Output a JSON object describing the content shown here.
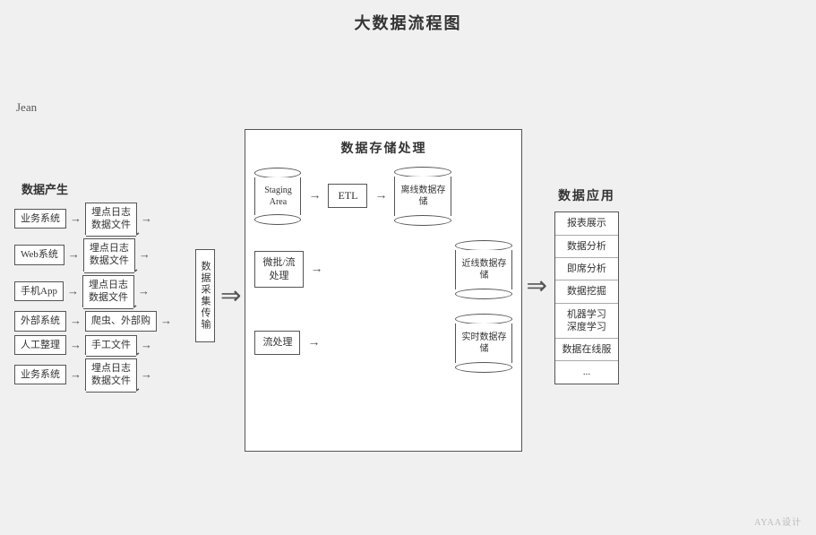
{
  "title": "大数据流程图",
  "sections": {
    "data_source": {
      "label": "数据产生",
      "rows": [
        {
          "left": "业务系统",
          "right_line1": "埋点日志",
          "right_line2": "数据文件",
          "wave": true
        },
        {
          "left": "Web系统",
          "right_line1": "埋点日志",
          "right_line2": "数据文件",
          "wave": true
        },
        {
          "left": "手机App",
          "right_line1": "埋点日志",
          "right_line2": "数据文件",
          "wave": true
        },
        {
          "left": "外部系统",
          "right_line1": "爬虫、外部购",
          "right_line2": "",
          "wave": false
        },
        {
          "left": "人工整理",
          "right_line1": "手工文件",
          "right_line2": "",
          "wave": true
        },
        {
          "left": "业务系统",
          "right_line1": "埋点日志",
          "right_line2": "数据文件",
          "wave": true
        }
      ]
    },
    "collect": {
      "label": "数据\n采集\n传输"
    },
    "storage": {
      "label": "数据存储处理",
      "rows": [
        {
          "left_label": "Staging\nArea",
          "process_label": "ETL",
          "right_label1": "离线数据存",
          "right_label2": "储"
        },
        {
          "left_label": "微批/流\n处理",
          "process_label": null,
          "right_label1": "近线数据存",
          "right_label2": "储"
        },
        {
          "left_label": "流处理",
          "process_label": null,
          "right_label1": "实时数据存",
          "right_label2": "储"
        }
      ]
    },
    "app": {
      "label": "数据应用",
      "items": [
        "报表展示",
        "数据分析",
        "即席分析",
        "数据挖掘",
        "机器学习\n深度学习",
        "数据在线服",
        "..."
      ]
    }
  },
  "watermark": "AYAA设计"
}
